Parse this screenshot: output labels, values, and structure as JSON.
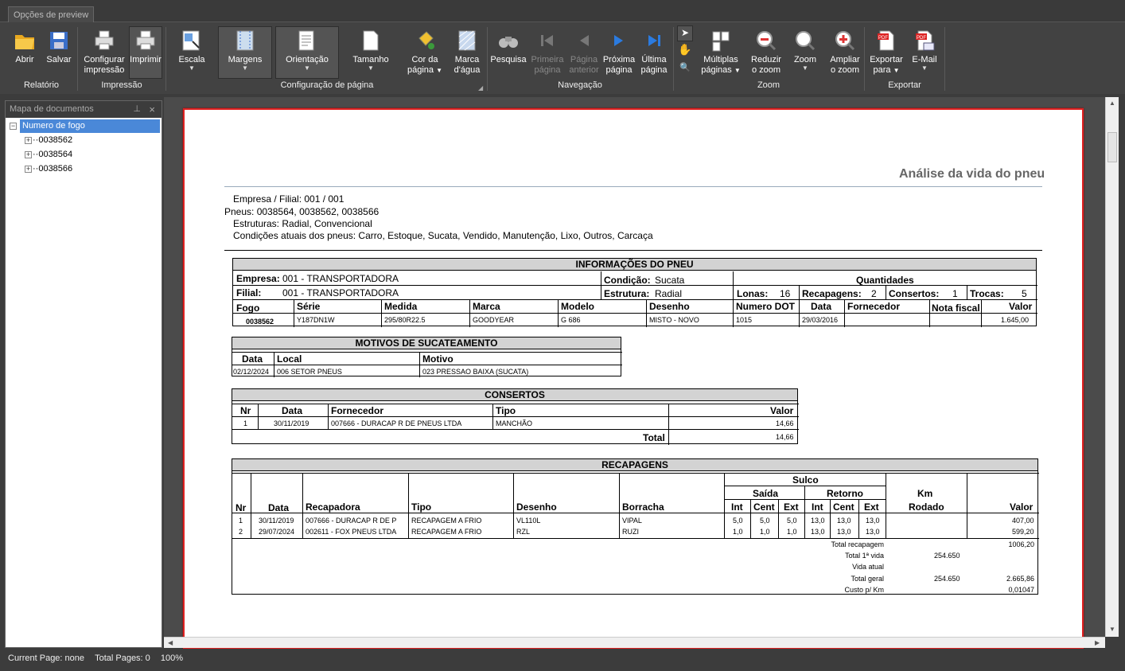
{
  "window": {
    "tab_label": "Opções de preview"
  },
  "ribbon": {
    "groups": {
      "relatorio": "Relatório",
      "impressao": "Impressão",
      "config": "Configuração de página",
      "navegacao": "Navegação",
      "zoom": "Zoom",
      "exportar": "Exportar"
    },
    "buttons": {
      "abrir": "Abrir",
      "salvar": "Salvar",
      "configurar": "Configurar",
      "configurar2": "impressão",
      "imprimir": "Imprimir",
      "escala": "Escala",
      "margens": "Margens",
      "orientacao": "Orientação",
      "tamanho": "Tamanho",
      "cor": "Cor da",
      "cor2": "página",
      "marca": "Marca",
      "marca2": "d'água",
      "pesquisa": "Pesquisa",
      "primeira": "Primeira",
      "primeira2": "página",
      "anterior": "Página",
      "anterior2": "anterior",
      "proxima": "Próxima",
      "proxima2": "página",
      "ultima": "Última",
      "ultima2": "página",
      "multiplas": "Múltiplas",
      "multiplas2": "páginas",
      "reduzir": "Reduzir",
      "reduzir2": "o zoom",
      "zoom": "Zoom",
      "ampliar": "Ampliar",
      "ampliar2": "o zoom",
      "exportar": "Exportar",
      "exportar2": "para",
      "email": "E-Mail"
    }
  },
  "docmap": {
    "title": "Mapa de documentos",
    "root": "Numero de fogo",
    "items": [
      "0038562",
      "0038564",
      "0038566"
    ]
  },
  "status": {
    "current": "Current Page: none",
    "total": "Total Pages: 0",
    "zoom": "100%"
  },
  "report": {
    "title": "Análise da vida do pneu",
    "header": {
      "empresa": "Empresa / Filial:  001 / 001",
      "pneus": "Pneus: 0038564,  0038562,  0038566",
      "estruturas": "Estruturas: Radial, Convencional",
      "condicoes": "Condições atuais dos pneus:  Carro, Estoque, Sucata, Vendido, Manutenção, Lixo, Outros, Carcaça"
    },
    "info": {
      "title": "INFORMAÇÕES DO PNEU",
      "empresa_label": "Empresa:",
      "empresa": "001 - TRANSPORTADORA",
      "filial_label": "Filial:",
      "filial": "001 - TRANSPORTADORA",
      "condicao_label": "Condição:",
      "condicao": "Sucata",
      "estrutura_label": "Estrutura:",
      "estrutura": "Radial",
      "quantidades": "Quantidades",
      "lonas_label": "Lonas:",
      "lonas": "16",
      "recap_label": "Recapagens:",
      "recap": "2",
      "consertos_label": "Consertos:",
      "consertos": "1",
      "trocas_label": "Trocas:",
      "trocas": "5",
      "cols": [
        "Fogo",
        "Série",
        "Medida",
        "Marca",
        "Modelo",
        "Desenho",
        "Numero DOT",
        "Data",
        "Fornecedor",
        "Nota fiscal",
        "Valor"
      ],
      "row": [
        "0038562",
        "Y187DN1W",
        "295/80R22.5",
        "GOODYEAR",
        "G 686",
        "MISTO - NOVO",
        "1015",
        "29/03/2016",
        "",
        "",
        "1.645,00"
      ]
    },
    "sucata": {
      "title": "MOTIVOS DE SUCATEAMENTO",
      "cols": [
        "Data",
        "Local",
        "Motivo"
      ],
      "row": [
        "02/12/2024",
        "006 SETOR PNEUS",
        "023 PRESSAO BAIXA (SUCATA)"
      ]
    },
    "consertos": {
      "title": "CONSERTOS",
      "cols": [
        "Nr",
        "Data",
        "Fornecedor",
        "Tipo",
        "Valor"
      ],
      "row": [
        "1",
        "30/11/2019",
        "007666 - DURACAP R DE PNEUS LTDA",
        "MANCHÃO",
        "14,66"
      ],
      "total_label": "Total",
      "total": "14,66"
    },
    "recapagens": {
      "title": "RECAPAGENS",
      "sulco": "Sulco",
      "saida": "Saída",
      "retorno": "Retorno",
      "km": "Km",
      "rodado": "Rodado",
      "cols": [
        "Nr",
        "Data",
        "Recapadora",
        "Tipo",
        "Desenho",
        "Borracha",
        "Int",
        "Cent",
        "Ext",
        "Int",
        "Cent",
        "Ext",
        "Valor"
      ],
      "rows": [
        [
          "1",
          "30/11/2019",
          "007666 - DURACAP R DE P",
          "RECAPAGEM A FRIO",
          "VL110L",
          "VIPAL",
          "5,0",
          "5,0",
          "5,0",
          "13,0",
          "13,0",
          "13,0",
          "407,00"
        ],
        [
          "2",
          "29/07/2024",
          "002611 - FOX PNEUS LTDA",
          "RECAPAGEM A FRIO",
          "RZL",
          "RUZI",
          "1,0",
          "1,0",
          "1,0",
          "13,0",
          "13,0",
          "13,0",
          "599,20"
        ]
      ],
      "totals": [
        {
          "label": "Total recapagem",
          "km": "",
          "valor": "1006,20"
        },
        {
          "label": "Total 1ª vida",
          "km": "254.650",
          "valor": ""
        },
        {
          "label": "Vida atual",
          "km": "",
          "valor": ""
        },
        {
          "label": "Total geral",
          "km": "254.650",
          "valor": "2.665,86"
        },
        {
          "label": "Custo p/ Km",
          "km": "",
          "valor": "0,01047"
        }
      ]
    }
  }
}
